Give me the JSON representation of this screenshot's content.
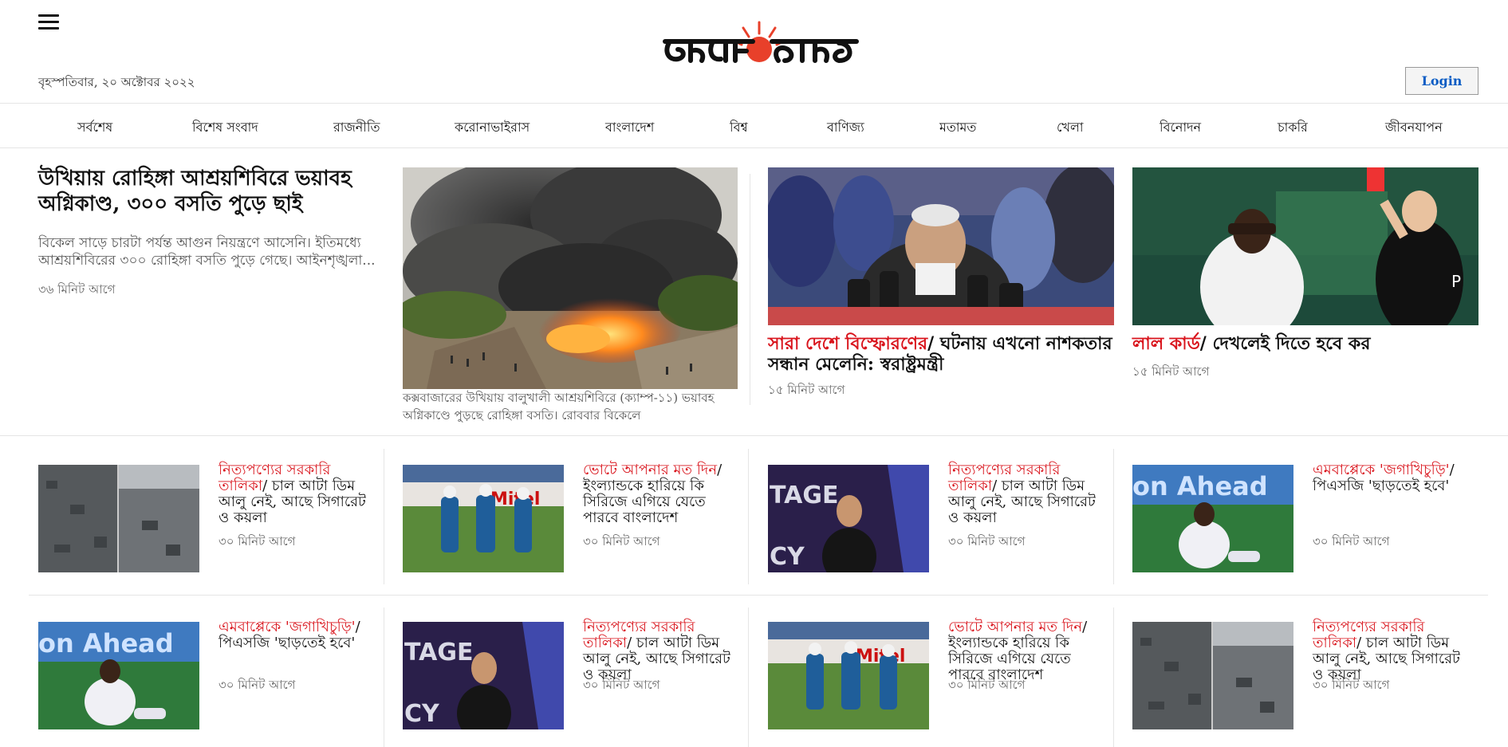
{
  "header": {
    "date": "বৃহস্পতিবার, ২০ অক্টোবর ২০২২",
    "login_label": "Login",
    "logo_text": "প্রথম আলো"
  },
  "nav": [
    "সর্বশেষ",
    "বিশেষ সংবাদ",
    "রাজনীতি",
    "করোনাভাইরাস",
    "বাংলাদেশ",
    "বিশ্ব",
    "বাণিজ্য",
    "মতামত",
    "খেলা",
    "বিনোদন",
    "চাকরি",
    "জীবনযাপন"
  ],
  "lead": {
    "title": "উখিয়ায় রোহিঙ্গা আশ্রয়শিবিরে ভয়াবহ অগ্নিকাণ্ড, ৩০০ বসতি পুড়ে ছাই",
    "summary": "বিকেল সাড়ে চারটা পর্যন্ত আগুন নিয়ন্ত্রণে আসেনি। ইতিমধ্যে আশ্রয়শিবিরের ৩০০ রোহিঙ্গা বসতি পুড়ে গেছে। আইনশৃঙ্খলা...",
    "time": "৩৬ মিনিট আগে",
    "caption": "কক্সবাজারের উখিয়ায় বালুখালী আশ্রয়শিবিরে (ক্যাম্প-১১) ভয়াবহ অগ্নিকাণ্ডে পুড়ছে রোহিঙ্গা বসতি। রোববার বিকেলে"
  },
  "featured": [
    {
      "kicker": "সারা দেশে বিস্ফোরণের",
      "headline": "ঘটনায় এখনো নাশকতার সন্ধান মেলেনি: স্বরাষ্ট্রমন্ত্রী",
      "time": "১৫ মিনিট আগে"
    },
    {
      "kicker": "লাল কার্ড",
      "headline": "দেখলেই দিতে হবে কর",
      "time": "১৫ মিনিট আগে"
    }
  ],
  "cards": [
    {
      "kicker": "নিত্যপণ্যের সরকারি তালিকা",
      "headline": "চাল আটা ডিম আলু নেই, আছে সিগারেট ও কয়লা",
      "time": "৩০ মিনিট আগে",
      "thumb": "rubble"
    },
    {
      "kicker": "ভোটে আপনার মত দিন",
      "headline": "ইংল্যান্ডকে হারিয়ে কি সিরিজে এগিয়ে যেতে পারবে বাংলাদেশ",
      "time": "৩০ মিনিট আগে",
      "thumb": "cricket"
    },
    {
      "kicker": "নিত্যপণ্যের সরকারি তালিকা",
      "headline": "চাল আটা ডিম আলু নেই, আছে সিগারেট ও কয়লা",
      "time": "৩০ মিনিট আগে",
      "thumb": "stage"
    },
    {
      "kicker": "এমবাপ্পেকে 'জগাখিচুড়ি'",
      "headline": "পিএসজি 'ছাড়তেই হবে'",
      "time": "৩০ মিনিট আগে",
      "thumb": "football"
    },
    {
      "kicker": "এমবাপ্পেকে 'জগাখিচুড়ি'",
      "headline": "পিএসজি 'ছাড়তেই হবে'",
      "time": "৩০ মিনিট আগে",
      "thumb": "football"
    },
    {
      "kicker": "নিত্যপণ্যের সরকারি তালিকা",
      "headline": "চাল আটা ডিম আলু নেই, আছে সিগারেট ও কয়লা",
      "time": "৩০ মিনিট আগে",
      "thumb": "stage"
    },
    {
      "kicker": "ভোটে আপনার মত দিন",
      "headline": "ইংল্যান্ডকে হারিয়ে কি সিরিজে এগিয়ে যেতে পারবে বাংলাদেশ",
      "time": "৩০ মিনিট আগে",
      "thumb": "cricket"
    },
    {
      "kicker": "নিত্যপণ্যের সরকারি তালিকা",
      "headline": "চাল আটা ডিম আলু নেই, আছে সিগারেট ও কয়লা",
      "time": "৩০ মিনিট আগে",
      "thumb": "rubble"
    }
  ],
  "photo_text": {
    "mitel": "Mitel",
    "tage": "TAGE",
    "cy": "CY",
    "on_ahead": "on Ahead"
  },
  "colors": {
    "accent_red": "#d9141c",
    "link_blue": "#0a5cc4",
    "logo_sun": "#e8402a"
  }
}
